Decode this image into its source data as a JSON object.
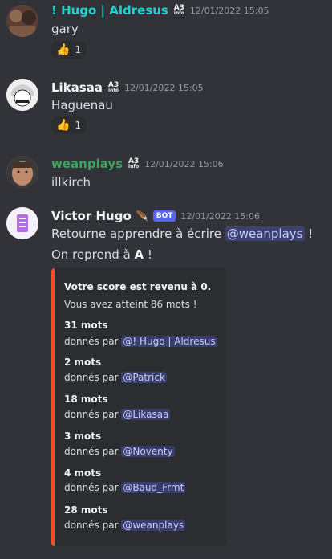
{
  "messages": [
    {
      "username": "! Hugo | Aldresus",
      "username_color": "#1fd1d1",
      "tag": [
        "A3",
        "info"
      ],
      "timestamp": "12/01/2022 15:05",
      "text": "gary",
      "reaction": {
        "emoji": "👍",
        "count": "1"
      }
    },
    {
      "username": "Likasaa",
      "username_color": "#f2f3f5",
      "tag": [
        "A3",
        "info"
      ],
      "timestamp": "12/01/2022 15:05",
      "text": "Haguenau",
      "reaction": {
        "emoji": "👍",
        "count": "1"
      }
    },
    {
      "username": "weanplays",
      "username_color": "#3ba55c",
      "tag": [
        "A3",
        "info"
      ],
      "timestamp": "12/01/2022 15:06",
      "text": "illkirch"
    },
    {
      "username": "Victor Hugo",
      "username_color": "#f2f3f5",
      "bot_badge": "BOT",
      "timestamp": "12/01/2022 15:06",
      "line1_prefix": "Retourne apprendre à écrire ",
      "line1_mention": "@weanplays",
      "line1_suffix": " !",
      "line2_prefix": "On reprend à ",
      "line2_letter": "A",
      "line2_suffix": " !"
    }
  ],
  "embed": {
    "accent": "#f04f1f",
    "title": "Votre score est revenu à 0.",
    "subtitle": "Vous avez atteint 86 mots !",
    "given_by": "donnés par",
    "entries": [
      {
        "count": "31 mots",
        "user": "@! Hugo | Aldresus"
      },
      {
        "count": "2 mots",
        "user": "@Patrick"
      },
      {
        "count": "18 mots",
        "user": "@Likasaa"
      },
      {
        "count": "3 mots",
        "user": "@Noventy"
      },
      {
        "count": "4 mots",
        "user": "@Baud_Frmt"
      },
      {
        "count": "28 mots",
        "user": "@weanplays"
      }
    ]
  }
}
